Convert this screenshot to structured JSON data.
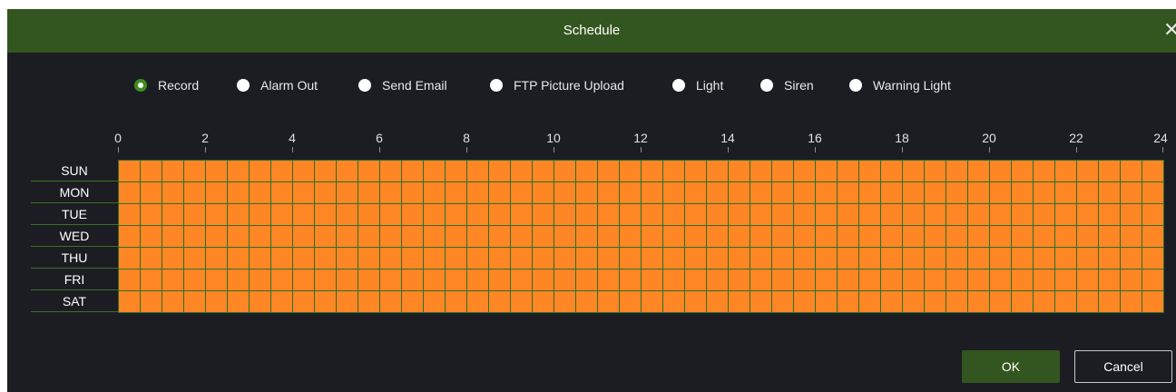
{
  "dialog": {
    "title": "Schedule",
    "close_icon": "✕"
  },
  "modes": [
    {
      "label": "Record",
      "selected": true
    },
    {
      "label": "Alarm Out",
      "selected": false
    },
    {
      "label": "Send Email",
      "selected": false
    },
    {
      "label": "FTP Picture Upload",
      "selected": false
    },
    {
      "label": "Light",
      "selected": false
    },
    {
      "label": "Siren",
      "selected": false
    },
    {
      "label": "Warning Light",
      "selected": false
    }
  ],
  "timeline": {
    "hours": [
      "0",
      "2",
      "4",
      "6",
      "8",
      "10",
      "12",
      "14",
      "16",
      "18",
      "20",
      "22",
      "24"
    ]
  },
  "schedule": {
    "days": [
      "SUN",
      "MON",
      "TUE",
      "WED",
      "THU",
      "FRI",
      "SAT"
    ],
    "slots_per_day": 48,
    "all_slots_active": true,
    "active_color": "#ff8625",
    "grid_line_color": "#2f6d2a"
  },
  "buttons": {
    "ok": "OK",
    "cancel": "Cancel"
  },
  "colors": {
    "header": "#33551f",
    "background": "#1c1d22",
    "accent": "#3f8c1f"
  }
}
